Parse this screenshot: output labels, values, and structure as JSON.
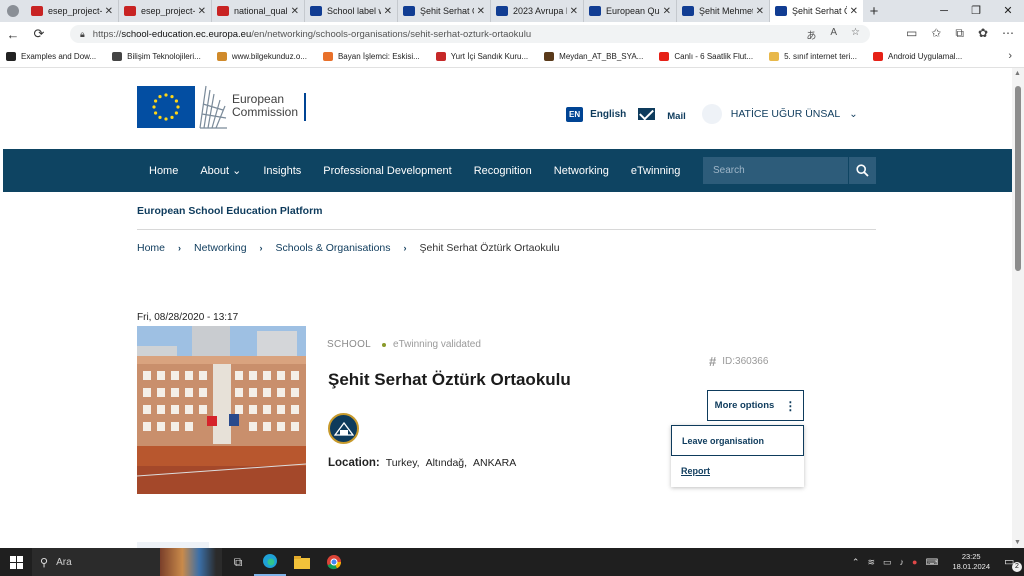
{
  "browser": {
    "tabs": [
      {
        "label": "esep_project-e",
        "icon": "pdf"
      },
      {
        "label": "esep_project-e",
        "icon": "pdf"
      },
      {
        "label": "national_quali",
        "icon": "pdf"
      },
      {
        "label": "School label w",
        "icon": "eu"
      },
      {
        "label": "Şehit Serhat Ö",
        "icon": "eu"
      },
      {
        "label": "2023 Avrupa K",
        "icon": "eu"
      },
      {
        "label": "European Qua",
        "icon": "eu"
      },
      {
        "label": "Şehit Mehmet",
        "icon": "eu"
      },
      {
        "label": "Şehit Serhat Ö",
        "icon": "eu",
        "active": true
      }
    ],
    "url_prefix": "https://",
    "url_host": "school-education.ec.europa.eu",
    "url_path": "/en/networking/schools-organisations/sehit-serhat-ozturk-ortaokulu",
    "bookmarks": [
      {
        "label": "Examples and Dow...",
        "color": "#222222"
      },
      {
        "label": "Bilişim Teknolojileri...",
        "color": "#444444"
      },
      {
        "label": "www.bilgekunduz.o...",
        "color": "#d08a2a"
      },
      {
        "label": "Bayan İşlemci: Eskisi...",
        "color": "#e8702a"
      },
      {
        "label": "Yurt İçi Sandık Kuru...",
        "color": "#c62828"
      },
      {
        "label": "Meydan_AT_BB_SYA...",
        "color": "#5a3a1a"
      },
      {
        "label": "Canlı - 6 Saatlik Flut...",
        "color": "#e62117"
      },
      {
        "label": "5. sınıf internet teri...",
        "color": "#e8b84a"
      },
      {
        "label": "Android Uygulamal...",
        "color": "#e62117"
      }
    ]
  },
  "header": {
    "logo_line1": "European",
    "logo_line2": "Commission",
    "lang_code": "EN",
    "lang_label": "English",
    "mail_label": "Mail",
    "user_name": "HATİCE UĞUR ÜNSAL"
  },
  "nav": {
    "items": [
      "Home",
      "About",
      "Insights",
      "Professional Development",
      "Recognition",
      "Networking",
      "eTwinning"
    ],
    "search_placeholder": "Search"
  },
  "platform_title": "European School Education Platform",
  "breadcrumb": {
    "items": [
      "Home",
      "Networking",
      "Schools & Organisations"
    ],
    "current": "Şehit Serhat Öztürk Ortaokulu"
  },
  "school": {
    "date": "Fri, 08/28/2020 - 13:17",
    "type": "SCHOOL",
    "status": "eTwinning validated",
    "name": "Şehit Serhat Öztürk Ortaokulu",
    "location_label": "Location:",
    "country": "Turkey,",
    "district": "Altındağ,",
    "city": "ANKARA",
    "id_label": "ID:360366",
    "more_options": "More options",
    "menu": {
      "leave": "Leave organisation",
      "report": "Report"
    }
  },
  "taskbar": {
    "search_text": "Ara",
    "time": "23:25",
    "date": "18.01.2024",
    "notifications": "2"
  },
  "colors": {
    "nav_bg": "#0e4462",
    "brand_blue": "#004494",
    "link": "#0e3b5c",
    "status_dot": "#8a9a2a"
  }
}
